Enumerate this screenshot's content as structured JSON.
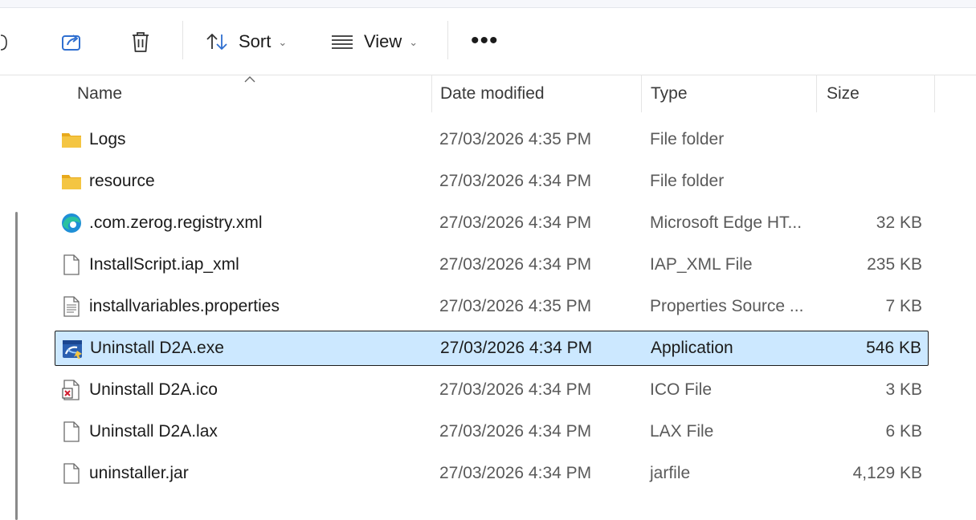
{
  "toolbar": {
    "sort_label": "Sort",
    "view_label": "View",
    "more_label": "•••"
  },
  "columns": {
    "name": "Name",
    "date": "Date modified",
    "type": "Type",
    "size": "Size"
  },
  "files": [
    {
      "name": "Logs",
      "date": "27/03/2026 4:35 PM",
      "type": "File folder",
      "size": "",
      "icon": "folder-icon"
    },
    {
      "name": "resource",
      "date": "27/03/2026 4:34 PM",
      "type": "File folder",
      "size": "",
      "icon": "folder-icon"
    },
    {
      "name": ".com.zerog.registry.xml",
      "date": "27/03/2026 4:34 PM",
      "type": "Microsoft Edge HT...",
      "size": "32 KB",
      "icon": "edge-icon"
    },
    {
      "name": "InstallScript.iap_xml",
      "date": "27/03/2026 4:34 PM",
      "type": "IAP_XML File",
      "size": "235 KB",
      "icon": "file-icon"
    },
    {
      "name": "installvariables.properties",
      "date": "27/03/2026 4:35 PM",
      "type": "Properties Source ...",
      "size": "7 KB",
      "icon": "text-file-icon"
    },
    {
      "name": "Uninstall D2A.exe",
      "date": "27/03/2026 4:34 PM",
      "type": "Application",
      "size": "546 KB",
      "icon": "application-icon",
      "selected": true
    },
    {
      "name": "Uninstall D2A.ico",
      "date": "27/03/2026 4:34 PM",
      "type": "ICO File",
      "size": "3 KB",
      "icon": "ico-file-icon"
    },
    {
      "name": "Uninstall D2A.lax",
      "date": "27/03/2026 4:34 PM",
      "type": "LAX File",
      "size": "6 KB",
      "icon": "file-icon"
    },
    {
      "name": "uninstaller.jar",
      "date": "27/03/2026 4:34 PM",
      "type": "jarfile",
      "size": "4,129 KB",
      "icon": "file-icon"
    }
  ],
  "colors": {
    "selection": "#cce8ff",
    "folder": "#f4c542",
    "edge": "#1f8fd6"
  }
}
